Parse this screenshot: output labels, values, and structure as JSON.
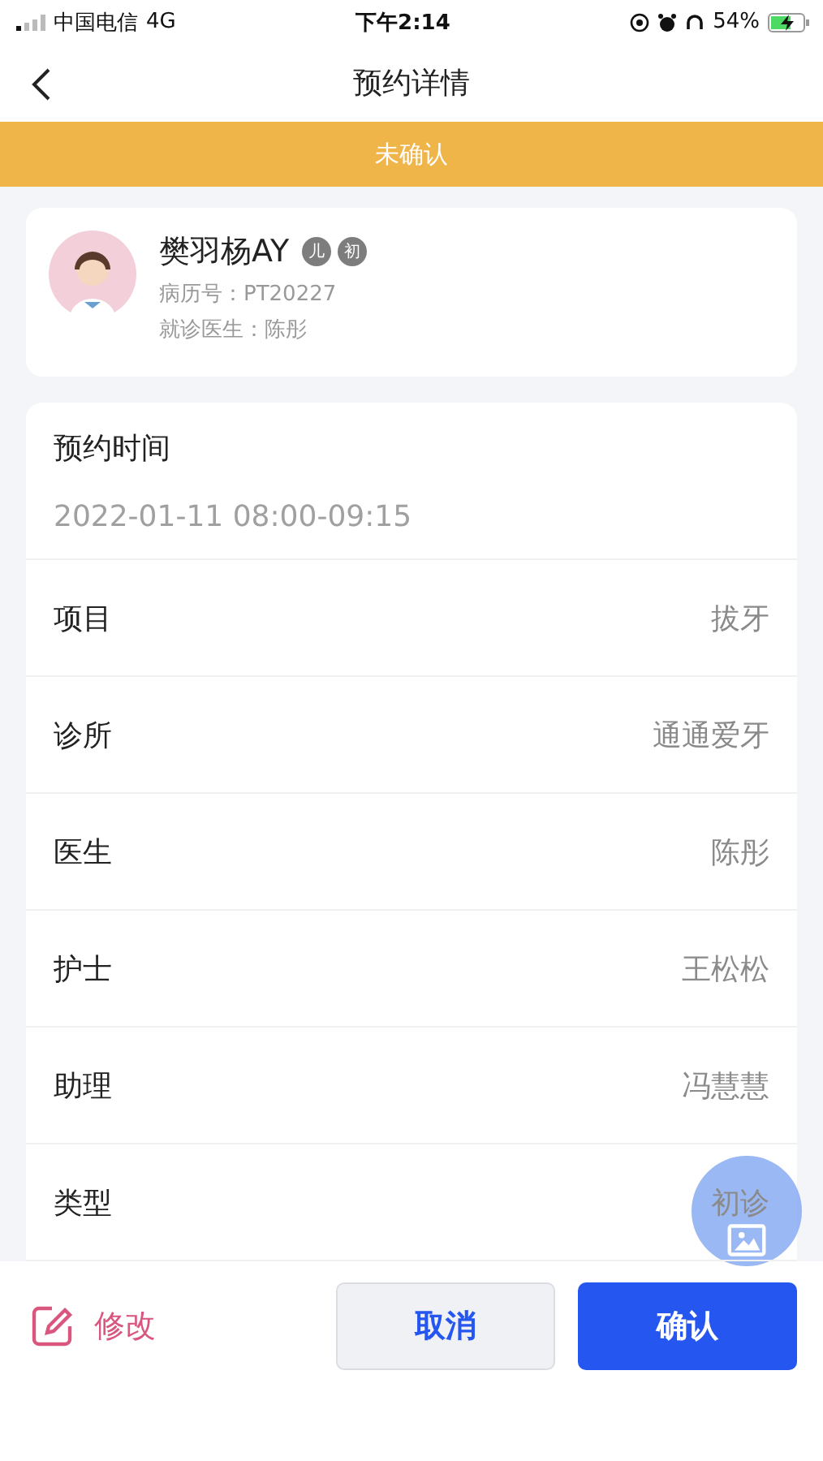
{
  "status_bar": {
    "carrier": "中国电信",
    "network": "4G",
    "time": "下午2:14",
    "battery": "54%"
  },
  "nav": {
    "title": "预约详情"
  },
  "banner": {
    "text": "未确认"
  },
  "patient": {
    "name": "樊羽杨AY",
    "tags": [
      "儿",
      "初"
    ],
    "record": "病历号：PT20227",
    "doctor": "就诊医生：陈彤"
  },
  "appointment": {
    "label": "预约时间",
    "value": "2022-01-11 08:00-09:15"
  },
  "details": [
    {
      "label": "项目",
      "value": "拔牙"
    },
    {
      "label": "诊所",
      "value": "通通爱牙"
    },
    {
      "label": "医生",
      "value": "陈彤"
    },
    {
      "label": "护士",
      "value": "王松松"
    },
    {
      "label": "助理",
      "value": "冯慧慧"
    },
    {
      "label": "类型",
      "value": "初诊"
    }
  ],
  "footer": {
    "edit": "修改",
    "cancel": "取消",
    "confirm": "确认"
  }
}
